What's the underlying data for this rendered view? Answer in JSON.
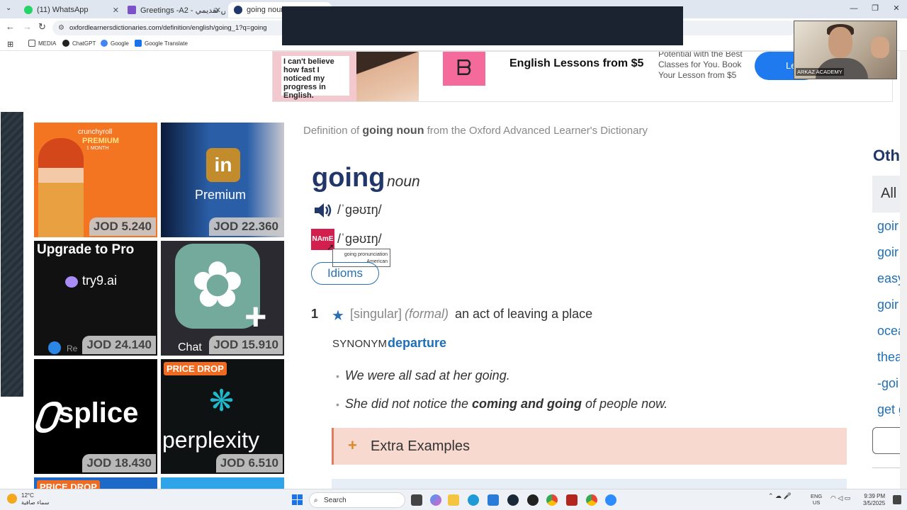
{
  "browser": {
    "tabs": [
      {
        "label": "(11) WhatsApp",
        "active": false
      },
      {
        "label": "Greetings -A2 - عرض تقديمي",
        "active": false
      },
      {
        "label": "going noun - De",
        "active": true
      }
    ],
    "url": "oxfordlearnersdictionaries.com/definition/english/going_1?q=going",
    "bookmarks": [
      "MEDIA",
      "ChatGPT",
      "Google",
      "Google Translate"
    ]
  },
  "webcam": {
    "label": "ARKAZ ACADEMY"
  },
  "top_ad": {
    "speech": "I can't believe how fast I noticed my progress in English.",
    "logo_glyph": "ᗷ",
    "headline": "English Lessons from $5",
    "body": "Potential with the Best Classes for You. Book Your Lesson from $5",
    "cta": "Le"
  },
  "ads": [
    {
      "brand": "crunchyroll",
      "sub": "PREMIUM",
      "sub2": "1 MONTH",
      "price": "JOD 5.240",
      "bg": "#f47521"
    },
    {
      "brand": "in",
      "sub": "Premium",
      "price": "JOD 22.360",
      "bg": "#2a5fa8"
    },
    {
      "brand": "Upgrade to Pro",
      "sub": "try9.ai",
      "extra": "Re",
      "price": "JOD 24.140",
      "bg": "#111111"
    },
    {
      "brand": "Chat",
      "price": "JOD 15.910",
      "bg": "#74aa9c"
    },
    {
      "brand": "splice",
      "price": "JOD 18.430",
      "bg": "#000000"
    },
    {
      "badge": "PRICE DROP",
      "brand": "perplexity",
      "price": "JOD 6.510",
      "bg": "#0e1212"
    },
    {
      "badge": "PRICE DROP",
      "bg": "#1d69c8"
    },
    {
      "bg": "#2fa4e8"
    }
  ],
  "dictionary": {
    "def_of_prefix": "Definition of",
    "def_of_word": "going noun",
    "def_of_suffix": "from the Oxford Advanced Learner's Dictionary",
    "headword": "going",
    "pos": "noun",
    "pron_br": "/ˈɡəʊɪŋ/",
    "name_label": "NAmE",
    "pron_am": "/ˈɡəʊɪŋ/",
    "tooltip_line1": "going pronunciation",
    "tooltip_line2": "American",
    "idioms": "Idioms",
    "sense_num": "1",
    "grammar": "[singular]",
    "register": "(formal)",
    "definition": "an act of leaving a place",
    "synonym_label": "SYNONYM",
    "synonym": "departure",
    "examples": [
      {
        "pre": "We were all sad at her going.",
        "bold": "",
        "post": ""
      },
      {
        "pre": "She did not notice the ",
        "bold": "coming and going",
        "post": " of people now."
      }
    ],
    "extra_examples": "Extra Examples"
  },
  "sidebar": {
    "title": "Othe",
    "tab_all": "All",
    "links": [
      "goir",
      "goir",
      "easy",
      "goir",
      "ocea",
      "thea",
      "-goi",
      "get g"
    ]
  },
  "taskbar": {
    "temp": "12°C",
    "weather": "سماء صافية",
    "search": "Search",
    "lang1": "ENG",
    "lang2": "US",
    "time": "9:39 PM",
    "date": "3/5/2025"
  }
}
